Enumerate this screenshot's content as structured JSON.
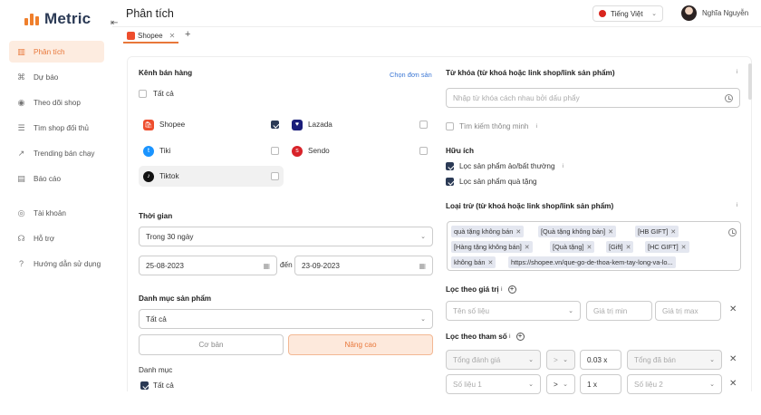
{
  "app": {
    "name": "Metric",
    "title": "Phân tích"
  },
  "sidebar": {
    "items": [
      {
        "label": "Phân tích",
        "icon": "chart-icon",
        "active": true
      },
      {
        "label": "Dự báo",
        "icon": "forecast-icon"
      },
      {
        "label": "Theo dõi shop",
        "icon": "eye-icon"
      },
      {
        "label": "Tìm shop đối thủ",
        "icon": "search-shop-icon"
      },
      {
        "label": "Trending bán chạy",
        "icon": "trending-icon"
      },
      {
        "label": "Báo cáo",
        "icon": "report-icon"
      },
      {
        "label": "Tài khoản",
        "icon": "account-icon"
      },
      {
        "label": "Hỗ trợ",
        "icon": "headset-icon"
      },
      {
        "label": "Hướng dẫn sử dụng",
        "icon": "help-icon"
      }
    ]
  },
  "header": {
    "language": "Tiếng Việt",
    "user_name": "Nghĩa Nguyễn"
  },
  "tabs": [
    {
      "label": "Shopee"
    }
  ],
  "left": {
    "channel_title": "Kênh bán hàng",
    "choose_shop": "Chọn đơn sản",
    "all_label": "Tất cả",
    "channels": [
      {
        "name": "Shopee",
        "checked": true,
        "color": "#ee4d2d"
      },
      {
        "name": "Lazada",
        "checked": false,
        "color": "#1a1d7a"
      },
      {
        "name": "Tiki",
        "checked": false,
        "color": "#1a94ff"
      },
      {
        "name": "Sendo",
        "checked": false,
        "color": "#d8232a"
      },
      {
        "name": "Tiktok",
        "checked": false,
        "color": "#111111"
      }
    ],
    "time_title": "Thời gian",
    "time_range": "Trong 30 ngày",
    "date_from": "25-08-2023",
    "date_to_label": "đến",
    "date_to": "23-09-2023",
    "category_title": "Danh mục sản phẩm",
    "category_value": "Tất cả",
    "btn_basic": "Cơ bản",
    "btn_advanced": "Nâng cao",
    "category_sub": "Danh mục",
    "category_all": "Tất cả"
  },
  "right": {
    "keyword_title": "Từ khóa (từ khoá hoặc link shop/link sản phẩm)",
    "keyword_placeholder": "Nhập từ khóa cách nhau bởi dấu phẩy",
    "smart_search": "Tìm kiếm thông minh",
    "useful_title": "Hữu ích",
    "filter_fake": "Lọc sản phẩm ảo/bất thường",
    "filter_gift": "Lọc sản phẩm quà tặng",
    "exclude_title": "Loại trừ (từ khoá hoặc link shop/link sản phẩm)",
    "exclude_tags": [
      "quà tặng không bán",
      "[Quà tặng không bán]",
      "[HB GIFT]",
      "[Hàng tặng không bán]",
      "[Quà tặng]",
      "[Gift]",
      "[HC GIFT]",
      "không bán",
      "https://shopee.vn/que-go-de-thoa-kem-tay-long-va-lo..."
    ],
    "value_filter_title": "Lọc theo giá trị",
    "metric_name_placeholder": "Tên số liệu",
    "min_placeholder": "Giá trị min",
    "max_placeholder": "Giá trị max",
    "param_filter_title": "Lọc theo tham số",
    "param_rows": [
      {
        "left": "Tổng đánh giá",
        "op": ">",
        "mult": "0.03 x",
        "right": "Tổng đã bán"
      },
      {
        "left": "Số liệu 1",
        "op": ">",
        "mult": "1 x",
        "right": "Số liệu 2"
      }
    ]
  }
}
